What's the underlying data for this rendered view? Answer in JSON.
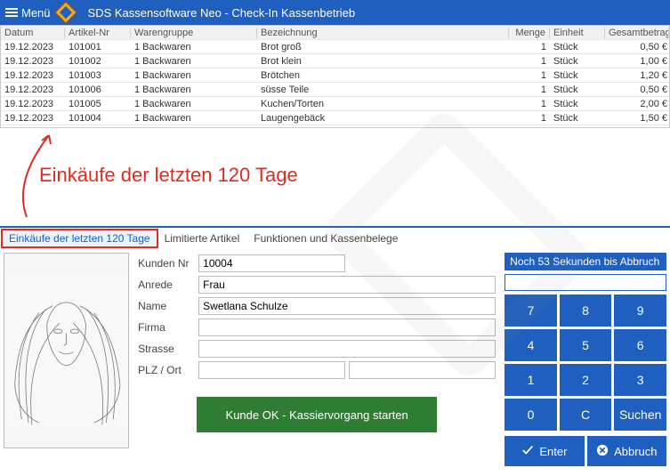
{
  "topbar": {
    "menu_label": "Menü",
    "app_title": "SDS Kassensoftware Neo - Check-In Kassenbetrieb"
  },
  "grid": {
    "headers": {
      "date": "Datum",
      "artnr": "Artikel-Nr",
      "wg": "Warengruppe",
      "bez": "Bezeichnung",
      "menge": "Menge",
      "einheit": "Einheit",
      "gesamt": "Gesamtbetrag"
    },
    "rows": [
      {
        "date": "19.12.2023",
        "artnr": "101001",
        "wg": "1 Backwaren",
        "bez": "Brot groß",
        "menge": "1",
        "einheit": "Stück",
        "gesamt": "0,50 €"
      },
      {
        "date": "19.12.2023",
        "artnr": "101002",
        "wg": "1 Backwaren",
        "bez": "Brot klein",
        "menge": "1",
        "einheit": "Stück",
        "gesamt": "1,00 €"
      },
      {
        "date": "19.12.2023",
        "artnr": "101003",
        "wg": "1 Backwaren",
        "bez": "Brötchen",
        "menge": "1",
        "einheit": "Stück",
        "gesamt": "1,20 €"
      },
      {
        "date": "19.12.2023",
        "artnr": "101006",
        "wg": "1 Backwaren",
        "bez": "süsse Teile",
        "menge": "1",
        "einheit": "Stück",
        "gesamt": "0,50 €"
      },
      {
        "date": "19.12.2023",
        "artnr": "101005",
        "wg": "1 Backwaren",
        "bez": "Kuchen/Torten",
        "menge": "1",
        "einheit": "Stück",
        "gesamt": "2,00 €"
      },
      {
        "date": "19.12.2023",
        "artnr": "101004",
        "wg": "1 Backwaren",
        "bez": "Laugengebäck",
        "menge": "1",
        "einheit": "Stück",
        "gesamt": "1,50 €"
      }
    ]
  },
  "annotation": {
    "text": "Einkäufe der letzten 120 Tage"
  },
  "tabs": {
    "t0": "Einkäufe der letzten 120 Tage",
    "t1": "Limitierte Artikel",
    "t2": "Funktionen und Kassenbelege"
  },
  "form": {
    "labels": {
      "kundennr": "Kunden Nr",
      "anrede": "Anrede",
      "name": "Name",
      "firma": "Firma",
      "strasse": "Strasse",
      "plzort": "PLZ / Ort"
    },
    "values": {
      "kundennr": "10004",
      "anrede": "Frau",
      "name": "Swetlana Schulze",
      "firma": "",
      "strasse": "",
      "plz": "",
      "ort": ""
    },
    "start_button": "Kunde OK - Kassiervorgang starten"
  },
  "keypad": {
    "countdown": "Noch 53 Sekunden bis Abbruch",
    "input_value": "",
    "keys": [
      "7",
      "8",
      "9",
      "4",
      "5",
      "6",
      "1",
      "2",
      "3",
      "0",
      "C",
      "Suchen"
    ],
    "enter": "Enter",
    "abort": "Abbruch"
  }
}
